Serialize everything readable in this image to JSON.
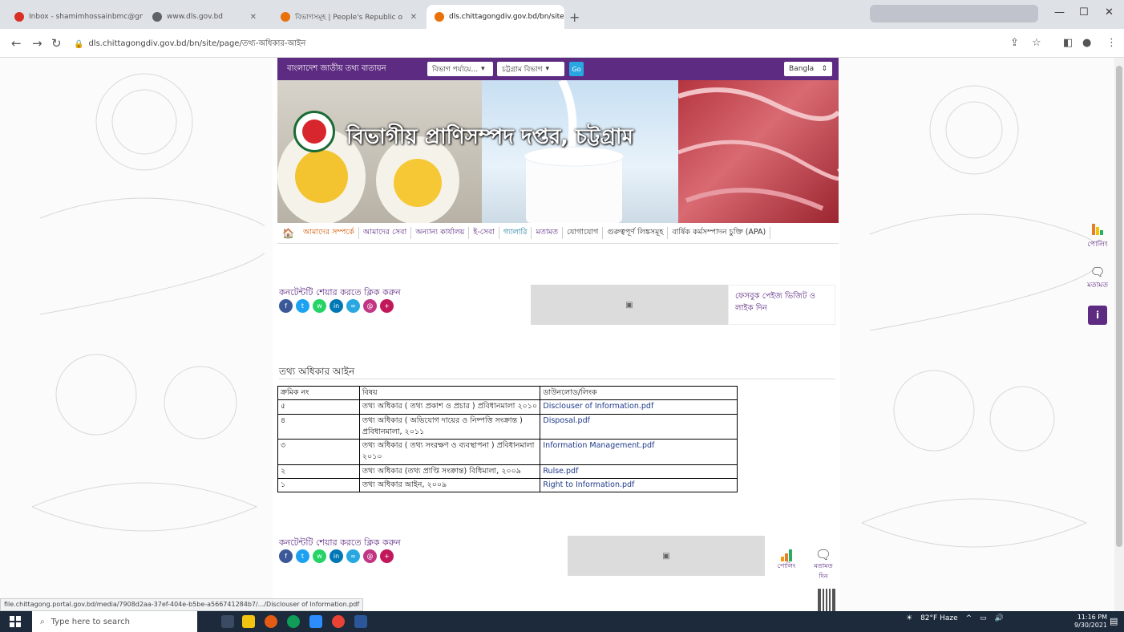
{
  "browser": {
    "tabs": [
      {
        "title": "Inbox - shamimhossainbmc@gm",
        "favicon_color": "#d93025"
      },
      {
        "title": "www.dls.gov.bd",
        "favicon_color": "#5f6368"
      },
      {
        "title": "বিভাগসমূহ | People's Republic o",
        "favicon_color": "#e8710a"
      },
      {
        "title": "dls.chittagongdiv.gov.bd/bn/site",
        "favicon_color": "#e8710a",
        "active": true
      }
    ],
    "new_tab_symbol": "+",
    "url": "dls.chittagongdiv.gov.bd/bn/site/page/তথ্য-অধিকার-আইন",
    "status_url": "file.chittagong.portal.gov.bd/media/7908d2aa-37ef-404e-b5be-a566741284b7/.../Disclouser of Information.pdf"
  },
  "site": {
    "portal_name": "বাংলাদেশ জাতীয় তথ্য বাতায়ন",
    "division_select": "বিভাগ পর্যায়ে...",
    "region_select": "চট্টগ্রাম বিভাগ",
    "go_label": "Go",
    "language_select": "Bangla",
    "title": "বিভাগীয় প্রাণিসম্পদ দপ্তর, চট্টগ্রাম",
    "menu": [
      "আমাদের সম্পর্কে",
      "আমাদের সেবা",
      "অন্যান্য কার্যালয়",
      "ই-সেবা",
      "গ্যালারি",
      "মতামত",
      "যোগাযোগ",
      "গুরুত্বপূর্ণ লিঙ্কসমূহ",
      "বার্ষিক কর্মসম্পাদন চুক্তি (APA)"
    ],
    "share_label": "কনটেন্টটি শেয়ার করতে ক্লিক করুন",
    "facebook_card": "ফেসবুক পেইজ ভিজিট ও লাইক দিন",
    "heading": "তথ্য অধিকার আইন",
    "table": {
      "headers": [
        "ক্রমিক নং",
        "বিষয়",
        "ডাউনলোড/লিংক"
      ],
      "rows": [
        [
          "৫",
          "তথ্য অধিকার ( তথ্য প্রকাশ ও প্রচার ) প্রবিধানমালা ২০১০",
          "Disclouser of Information.pdf"
        ],
        [
          "৪",
          "তথ্য অধিকার ( অভিযোগ দায়ের ও নিষ্পত্তি সংক্রান্ত ) প্রবিধানমালা, ২০১১",
          "Disposal.pdf"
        ],
        [
          "৩",
          "তথ্য অধিকার ( তথ্য সংরক্ষণ ও ব্যবস্থাপনা ) প্রবিধানমালা ২০১০",
          "Information Management.pdf"
        ],
        [
          "২",
          "তথ্য অধিকার (তথ্য প্রাপ্তি সংক্রান্ত) বিধিমালা, ২০০৯",
          "Rulse.pdf"
        ],
        [
          "১",
          "তথ্য অধিকার আইন, ২০০৯",
          "Right to Information.pdf"
        ]
      ]
    },
    "poll_label": "পোলিং",
    "opinion_label": "মতামত দিন",
    "side_poll_label": "পোলিং",
    "side_opinion_label": "মতামত",
    "info_label": "i"
  },
  "taskbar": {
    "search_placeholder": "Type here to search",
    "weather": "82°F Haze",
    "time": "11:16 PM",
    "date": "9/30/2021"
  }
}
